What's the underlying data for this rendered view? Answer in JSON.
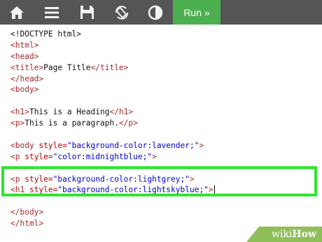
{
  "toolbar": {
    "icons": [
      "home-icon",
      "menu-icon",
      "save-icon",
      "rotate-icon",
      "contrast-icon"
    ],
    "run_label": "Run »",
    "background": "#555555",
    "run_color": "#4CAF50"
  },
  "code_lines": [
    [
      {
        "t": "<!DOCTYPE html>",
        "c": "txt"
      }
    ],
    [
      {
        "t": "<html>",
        "c": "tag"
      }
    ],
    [
      {
        "t": "<head>",
        "c": "tag"
      }
    ],
    [
      {
        "t": "<title>",
        "c": "tag"
      },
      {
        "t": "Page Title",
        "c": "txt"
      },
      {
        "t": "</title>",
        "c": "tag"
      }
    ],
    [
      {
        "t": "</head>",
        "c": "tag"
      }
    ],
    [
      {
        "t": "<body>",
        "c": "tag"
      }
    ],
    [],
    [
      {
        "t": "<h1>",
        "c": "tag"
      },
      {
        "t": "This is a Heading",
        "c": "txt"
      },
      {
        "t": "</h1>",
        "c": "tag"
      }
    ],
    [
      {
        "t": "<p>",
        "c": "tag"
      },
      {
        "t": "This is a paragraph.",
        "c": "txt"
      },
      {
        "t": "</p>",
        "c": "tag"
      }
    ],
    [],
    [
      {
        "t": "<body ",
        "c": "tag"
      },
      {
        "t": "style=",
        "c": "attr"
      },
      {
        "t": "\"background-color:lavender;\"",
        "c": "val"
      },
      {
        "t": ">",
        "c": "tag"
      }
    ],
    [
      {
        "t": "<p ",
        "c": "tag"
      },
      {
        "t": "style=",
        "c": "attr"
      },
      {
        "t": "\"color:midnightblue;\"",
        "c": "val"
      },
      {
        "t": ">",
        "c": "tag"
      }
    ],
    [],
    [
      {
        "t": "<p ",
        "c": "tag"
      },
      {
        "t": "style=",
        "c": "attr"
      },
      {
        "t": "\"background-color:lightgrey;\"",
        "c": "val"
      },
      {
        "t": ">",
        "c": "tag"
      }
    ],
    [
      {
        "t": "<h1 ",
        "c": "tag"
      },
      {
        "t": "style=",
        "c": "attr"
      },
      {
        "t": "\"background-color:lightskyblue;\"",
        "c": "val"
      },
      {
        "t": ">",
        "c": "tag"
      },
      {
        "cursor": true
      }
    ],
    [],
    [
      {
        "t": "</body>",
        "c": "tag"
      }
    ],
    [
      {
        "t": "</html>",
        "c": "tag"
      }
    ]
  ],
  "highlight_color": "#2ee62e",
  "watermark": {
    "part1": "wiki",
    "part2": "How"
  }
}
